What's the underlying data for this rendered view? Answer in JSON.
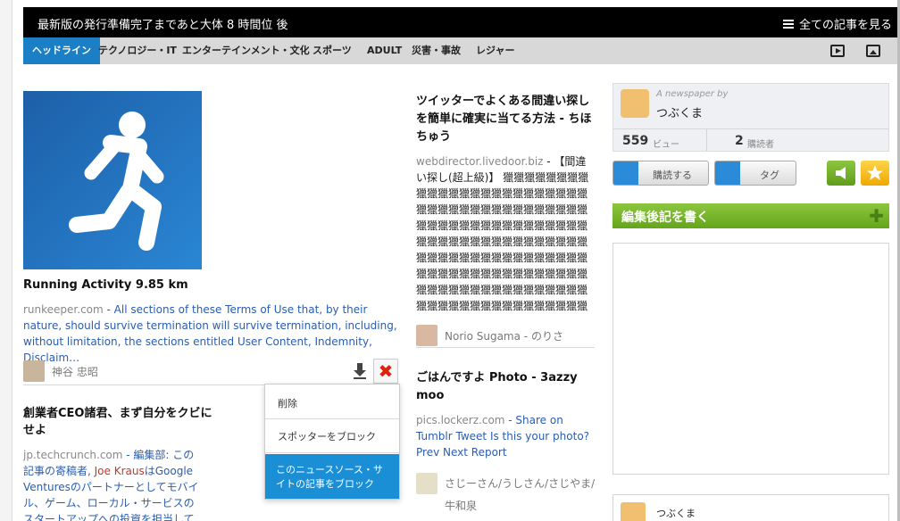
{
  "topbar": {
    "message": "最新版の発行準備完了まであと大体 8 時間位 後",
    "all_articles": "全ての記事を見る"
  },
  "nav": {
    "items": [
      {
        "label": "ヘッドライン",
        "active": true
      },
      {
        "label": "テクノロジー・IT",
        "active": false
      },
      {
        "label": "エンターテインメント・文化",
        "active": false
      },
      {
        "label": "スポーツ",
        "active": false
      },
      {
        "label": "ADULT",
        "active": false
      },
      {
        "label": "災害・事故",
        "active": false
      },
      {
        "label": "レジャー",
        "active": false
      }
    ]
  },
  "articles": {
    "a1": {
      "title": "Running Activity 9.85 km",
      "source": "runkeeper.com",
      "text": " - All sections of these Terms of Use that, by their nature, should survive termination will survive termination, including, without limitation, the sections entitled User Content, Indemnity, Disclaim…",
      "user": "神谷 忠昭"
    },
    "a2": {
      "title": "創業者CEO諸君、まず自分をクビにせよ",
      "source": "jp.techcrunch.com",
      "text_prefix": " - 編集部: この記事の寄稿者, ",
      "text_highlight": "Joe Kraus",
      "text_suffix": "はGoogle Venturesのパートナーとしてモバイル、ゲーム、ローカル・サービスのスタートアップへの投資を担当している..."
    },
    "a3": {
      "title": "ツイッターでよくある間違い探しを簡単に確実に当てる方法 - ちほちゅう",
      "source": "webdirector.livedoor.biz",
      "text": " - 【間違い探し(超上級)】 獵獵獵獵獵獵獵獵獵獵獵獵獵獵獵獵獵獵獵獵獵獵獵獵獵獵獵獵獵獵獵獵獵獵獵獵獵獵獵獵獵獵獵獵獵獵獵獵獵獵獵獵獵獵獵獵獵獵獵獵獵獵獵獵獵獵獵獵獵獵獵獵獵獵獵獵獵獵獵獵獵獵獵獵獵獵獵獵獵獵獵獵獵獵獵獵獵獵獵獵獵獵獵獵獵獵獵獵獵獵獵獵獵獵獵獵獵獵獵獵獵獵獵獵獵獵獵獵獵獵獵獵獵獵獵獵獵獵 できたらRT",
      "user": "Norio Sugama - のりさ"
    },
    "a4": {
      "title": "ごはんですよ Photo - 3azzy moo",
      "source": "pics.lockerz.com",
      "text": " - Share on Tumblr Tweet Is this your photo? Prev Next Report",
      "user": "さじーさん/うしさん/さじやま/牛和泉"
    }
  },
  "menu": {
    "delete": "削除",
    "block_spotter": "スポッターをブロック",
    "block_source": "このニュースソース・サイトの記事をブロック"
  },
  "sidebar": {
    "newspaper_by": "A newspaper by",
    "author": "つぶくま",
    "views_count": "559",
    "views_label": "ビュー",
    "subscribers_count": "2",
    "subscribers_label": "購読者",
    "subscribe_button": "購読する",
    "tag_button": "タグ",
    "editor_note": "編集後記を書く",
    "bottom_author": "つぶくま"
  },
  "colors": {
    "accent": "#1a7fc4",
    "green": "#7ab82c",
    "star": "#f2b400"
  }
}
